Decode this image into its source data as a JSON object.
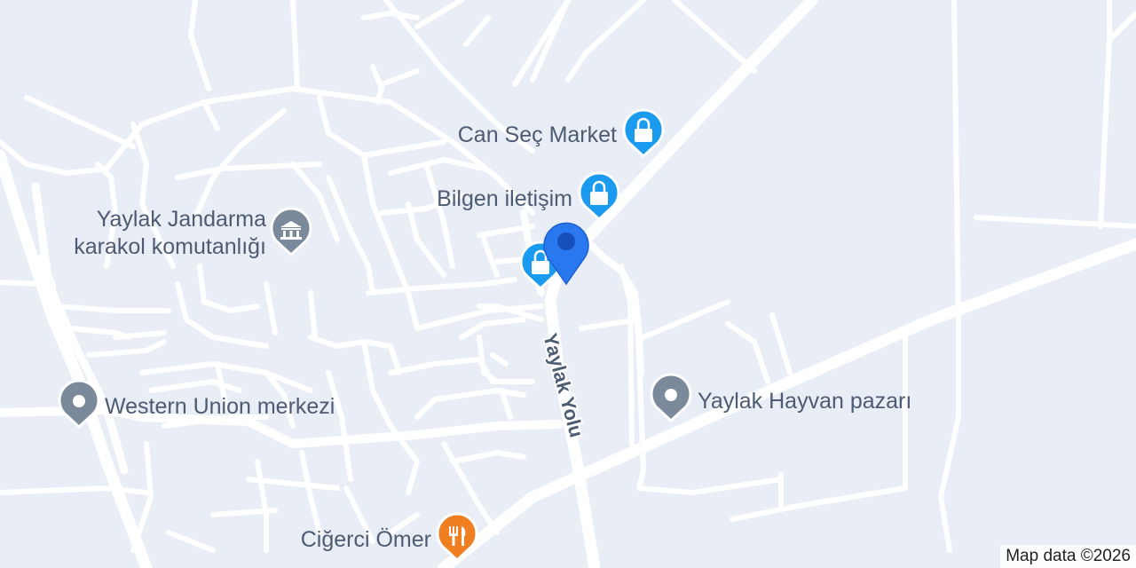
{
  "map": {
    "road_label": "Yaylak Yolu",
    "attribution": "Map data ©2026",
    "colors": {
      "background": "#e9edf6",
      "road": "#ffffff",
      "shopping_pin": "#1a9bf0",
      "generic_pin": "#7b8a9a",
      "government_pin": "#7b8a9a",
      "restaurant_pin": "#f07f22",
      "location_marker": "#2a78f0",
      "label_text": "#4d5b73"
    },
    "places": [
      {
        "name": "Can Seç Market",
        "type": "shopping",
        "icon": "shopping-bag-icon"
      },
      {
        "name": "Bilgen iletişim",
        "type": "shopping",
        "icon": "shopping-bag-icon"
      },
      {
        "name": "",
        "type": "shopping",
        "icon": "shopping-bag-icon"
      },
      {
        "name_lines": [
          "Yaylak Jandarma",
          "karakol komutanlığı"
        ],
        "type": "government",
        "icon": "government-building-icon"
      },
      {
        "name": "Western Union merkezi",
        "type": "generic",
        "icon": "place-pin-icon"
      },
      {
        "name": "Yaylak Hayvan pazarı",
        "type": "generic",
        "icon": "place-pin-icon"
      },
      {
        "name": "Ciğerci Ömer",
        "type": "restaurant",
        "icon": "fork-knife-icon"
      }
    ]
  }
}
